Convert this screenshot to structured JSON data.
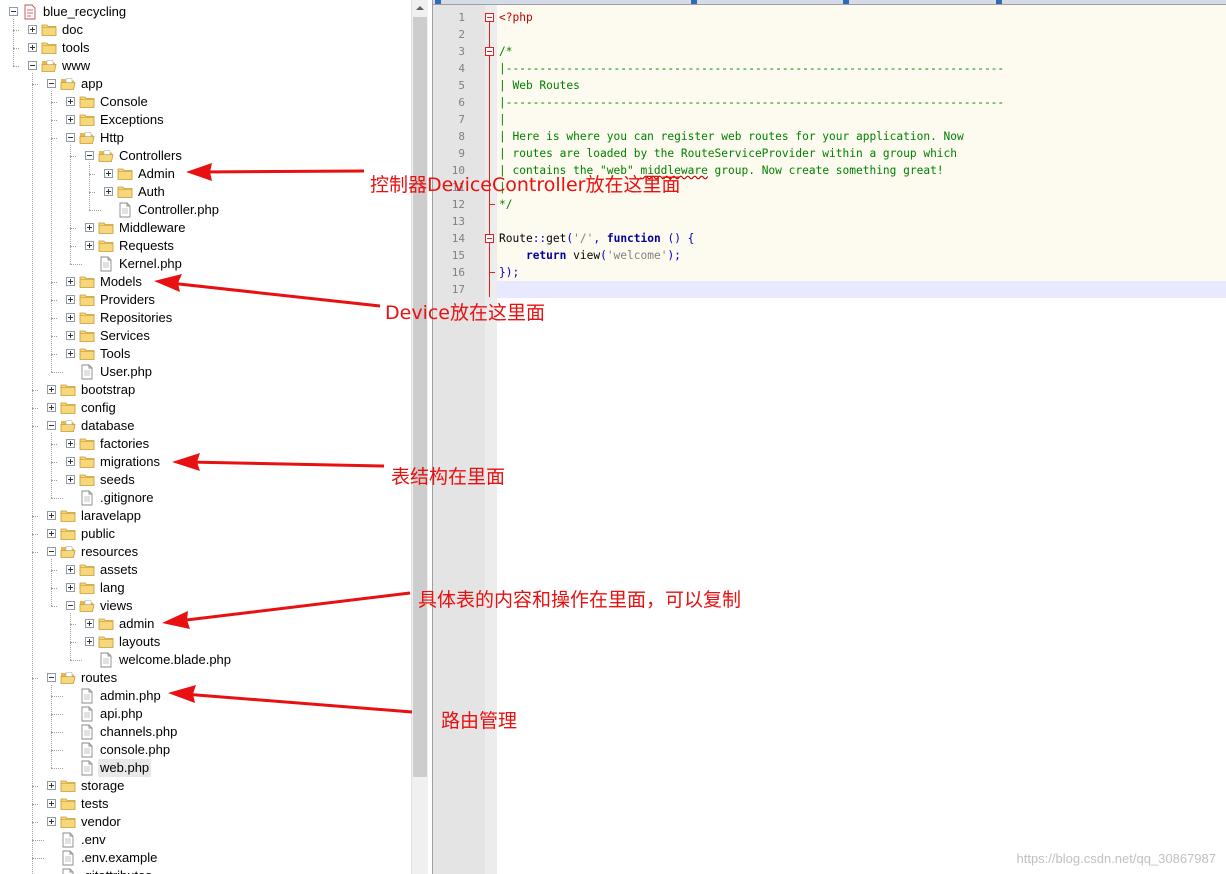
{
  "tree": {
    "items": [
      {
        "label": "blue_recycling",
        "depth": 0,
        "kind": "project",
        "exp": "minus"
      },
      {
        "label": "doc",
        "depth": 1,
        "kind": "folder",
        "exp": "plus"
      },
      {
        "label": "tools",
        "depth": 1,
        "kind": "folder",
        "exp": "plus"
      },
      {
        "label": "www",
        "depth": 1,
        "kind": "folder-open",
        "exp": "minus"
      },
      {
        "label": "app",
        "depth": 2,
        "kind": "folder-open",
        "exp": "minus"
      },
      {
        "label": "Console",
        "depth": 3,
        "kind": "folder",
        "exp": "plus"
      },
      {
        "label": "Exceptions",
        "depth": 3,
        "kind": "folder",
        "exp": "plus"
      },
      {
        "label": "Http",
        "depth": 3,
        "kind": "folder-open",
        "exp": "minus"
      },
      {
        "label": "Controllers",
        "depth": 4,
        "kind": "folder-open",
        "exp": "minus"
      },
      {
        "label": "Admin",
        "depth": 5,
        "kind": "folder",
        "exp": "plus"
      },
      {
        "label": "Auth",
        "depth": 5,
        "kind": "folder",
        "exp": "plus"
      },
      {
        "label": "Controller.php",
        "depth": 5,
        "kind": "file",
        "exp": "none"
      },
      {
        "label": "Middleware",
        "depth": 4,
        "kind": "folder",
        "exp": "plus"
      },
      {
        "label": "Requests",
        "depth": 4,
        "kind": "folder",
        "exp": "plus"
      },
      {
        "label": "Kernel.php",
        "depth": 4,
        "kind": "file",
        "exp": "none"
      },
      {
        "label": "Models",
        "depth": 3,
        "kind": "folder",
        "exp": "plus"
      },
      {
        "label": "Providers",
        "depth": 3,
        "kind": "folder",
        "exp": "plus"
      },
      {
        "label": "Repositories",
        "depth": 3,
        "kind": "folder",
        "exp": "plus"
      },
      {
        "label": "Services",
        "depth": 3,
        "kind": "folder",
        "exp": "plus"
      },
      {
        "label": "Tools",
        "depth": 3,
        "kind": "folder",
        "exp": "plus"
      },
      {
        "label": "User.php",
        "depth": 3,
        "kind": "file",
        "exp": "none"
      },
      {
        "label": "bootstrap",
        "depth": 2,
        "kind": "folder",
        "exp": "plus"
      },
      {
        "label": "config",
        "depth": 2,
        "kind": "folder",
        "exp": "plus"
      },
      {
        "label": "database",
        "depth": 2,
        "kind": "folder-open",
        "exp": "minus"
      },
      {
        "label": "factories",
        "depth": 3,
        "kind": "folder",
        "exp": "plus"
      },
      {
        "label": "migrations",
        "depth": 3,
        "kind": "folder",
        "exp": "plus"
      },
      {
        "label": "seeds",
        "depth": 3,
        "kind": "folder",
        "exp": "plus"
      },
      {
        "label": ".gitignore",
        "depth": 3,
        "kind": "file",
        "exp": "none"
      },
      {
        "label": "laravelapp",
        "depth": 2,
        "kind": "folder",
        "exp": "plus"
      },
      {
        "label": "public",
        "depth": 2,
        "kind": "folder",
        "exp": "plus"
      },
      {
        "label": "resources",
        "depth": 2,
        "kind": "folder-open",
        "exp": "minus"
      },
      {
        "label": "assets",
        "depth": 3,
        "kind": "folder",
        "exp": "plus"
      },
      {
        "label": "lang",
        "depth": 3,
        "kind": "folder",
        "exp": "plus"
      },
      {
        "label": "views",
        "depth": 3,
        "kind": "folder-open",
        "exp": "minus"
      },
      {
        "label": "admin",
        "depth": 4,
        "kind": "folder",
        "exp": "plus"
      },
      {
        "label": "layouts",
        "depth": 4,
        "kind": "folder",
        "exp": "plus"
      },
      {
        "label": "welcome.blade.php",
        "depth": 4,
        "kind": "file",
        "exp": "none"
      },
      {
        "label": "routes",
        "depth": 2,
        "kind": "folder-open",
        "exp": "minus"
      },
      {
        "label": "admin.php",
        "depth": 3,
        "kind": "file",
        "exp": "none"
      },
      {
        "label": "api.php",
        "depth": 3,
        "kind": "file",
        "exp": "none"
      },
      {
        "label": "channels.php",
        "depth": 3,
        "kind": "file",
        "exp": "none"
      },
      {
        "label": "console.php",
        "depth": 3,
        "kind": "file",
        "exp": "none"
      },
      {
        "label": "web.php",
        "depth": 3,
        "kind": "file",
        "exp": "none",
        "selected": true
      },
      {
        "label": "storage",
        "depth": 2,
        "kind": "folder",
        "exp": "plus"
      },
      {
        "label": "tests",
        "depth": 2,
        "kind": "folder",
        "exp": "plus"
      },
      {
        "label": "vendor",
        "depth": 2,
        "kind": "folder",
        "exp": "plus"
      },
      {
        "label": ".env",
        "depth": 2,
        "kind": "file",
        "exp": "none"
      },
      {
        "label": ".env.example",
        "depth": 2,
        "kind": "file",
        "exp": "none"
      },
      {
        "label": ".gitattributes",
        "depth": 2,
        "kind": "file",
        "exp": "none"
      }
    ]
  },
  "editor": {
    "lines": [
      [
        {
          "t": "<?php",
          "c": "red"
        }
      ],
      [],
      [
        {
          "t": "/*",
          "c": "green"
        }
      ],
      [
        {
          "t": "|--------------------------------------------------------------------------",
          "c": "green"
        }
      ],
      [
        {
          "t": "| Web Routes",
          "c": "green"
        }
      ],
      [
        {
          "t": "|--------------------------------------------------------------------------",
          "c": "green"
        }
      ],
      [
        {
          "t": "|",
          "c": "green"
        }
      ],
      [
        {
          "t": "| Here is where you can register web routes for your application. Now",
          "c": "green"
        }
      ],
      [
        {
          "t": "| routes are loaded by the RouteServiceProvider within a group which",
          "c": "green"
        }
      ],
      [
        {
          "t": "| contains the \"web\" ",
          "c": "green"
        },
        {
          "t": "middleware",
          "c": "green",
          "sq": true
        },
        {
          "t": " group. Now create something great!",
          "c": "green"
        }
      ],
      [
        {
          "t": "|",
          "c": "green"
        }
      ],
      [
        {
          "t": "*/",
          "c": "green"
        }
      ],
      [],
      [
        {
          "t": "Route",
          "c": "fn"
        },
        {
          "t": "::",
          "c": "blue"
        },
        {
          "t": "get",
          "c": "fn"
        },
        {
          "t": "(",
          "c": "blue"
        },
        {
          "t": "'/'",
          "c": "str"
        },
        {
          "t": ", ",
          "c": "blue"
        },
        {
          "t": "function",
          "c": "kw"
        },
        {
          "t": " () {",
          "c": "blue"
        }
      ],
      [
        {
          "t": "    ",
          "c": "fn"
        },
        {
          "t": "return",
          "c": "kw"
        },
        {
          "t": " view",
          "c": "fn"
        },
        {
          "t": "(",
          "c": "blue"
        },
        {
          "t": "'welcome'",
          "c": "str"
        },
        {
          "t": ");",
          "c": "blue"
        }
      ],
      [
        {
          "t": "});",
          "c": "blue"
        }
      ],
      []
    ]
  },
  "annotations": {
    "controllers_note": "控制器DeviceController放在这里面",
    "models_note": "Device放在这里面",
    "migrations_note": "表结构在里面",
    "views_note": "具体表的内容和操作在里面，可以复制",
    "routes_note": "路由管理"
  },
  "watermark": "https://blog.csdn.net/qq_30867987",
  "colors": {
    "annotation": "#e81010",
    "folder": "#f5d26b",
    "comment": "#008000",
    "keyword": "#0000a0"
  }
}
